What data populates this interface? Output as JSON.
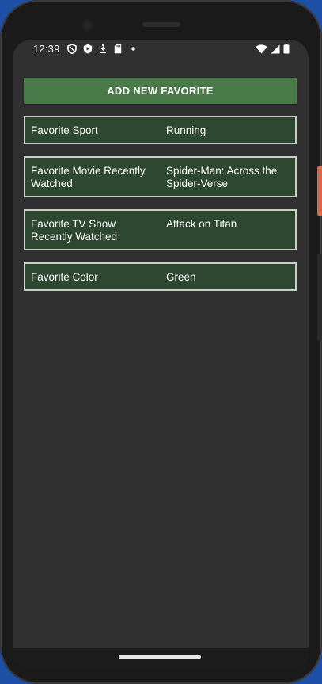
{
  "status_bar": {
    "time": "12:39",
    "left_icons": [
      "shield-outline-icon",
      "shield-play-icon",
      "download-icon",
      "sd-card-icon",
      "dot-icon"
    ],
    "right_icons": [
      "wifi-icon",
      "cell-signal-icon",
      "battery-icon"
    ]
  },
  "main": {
    "add_button_label": "ADD NEW FAVORITE",
    "favorites": [
      {
        "label": "Favorite Sport",
        "value": "Running"
      },
      {
        "label": "Favorite Movie Recently Watched",
        "value": "Spider-Man: Across the Spider-Verse"
      },
      {
        "label": "Favorite TV Show Recently Watched",
        "value": "Attack on Titan"
      },
      {
        "label": "Favorite Color",
        "value": "Green"
      }
    ]
  },
  "colors": {
    "background": "#303030",
    "button": "#4a7a49",
    "item_background": "#2e4730",
    "item_border": "#c9cfc8",
    "text": "#ffffff"
  }
}
